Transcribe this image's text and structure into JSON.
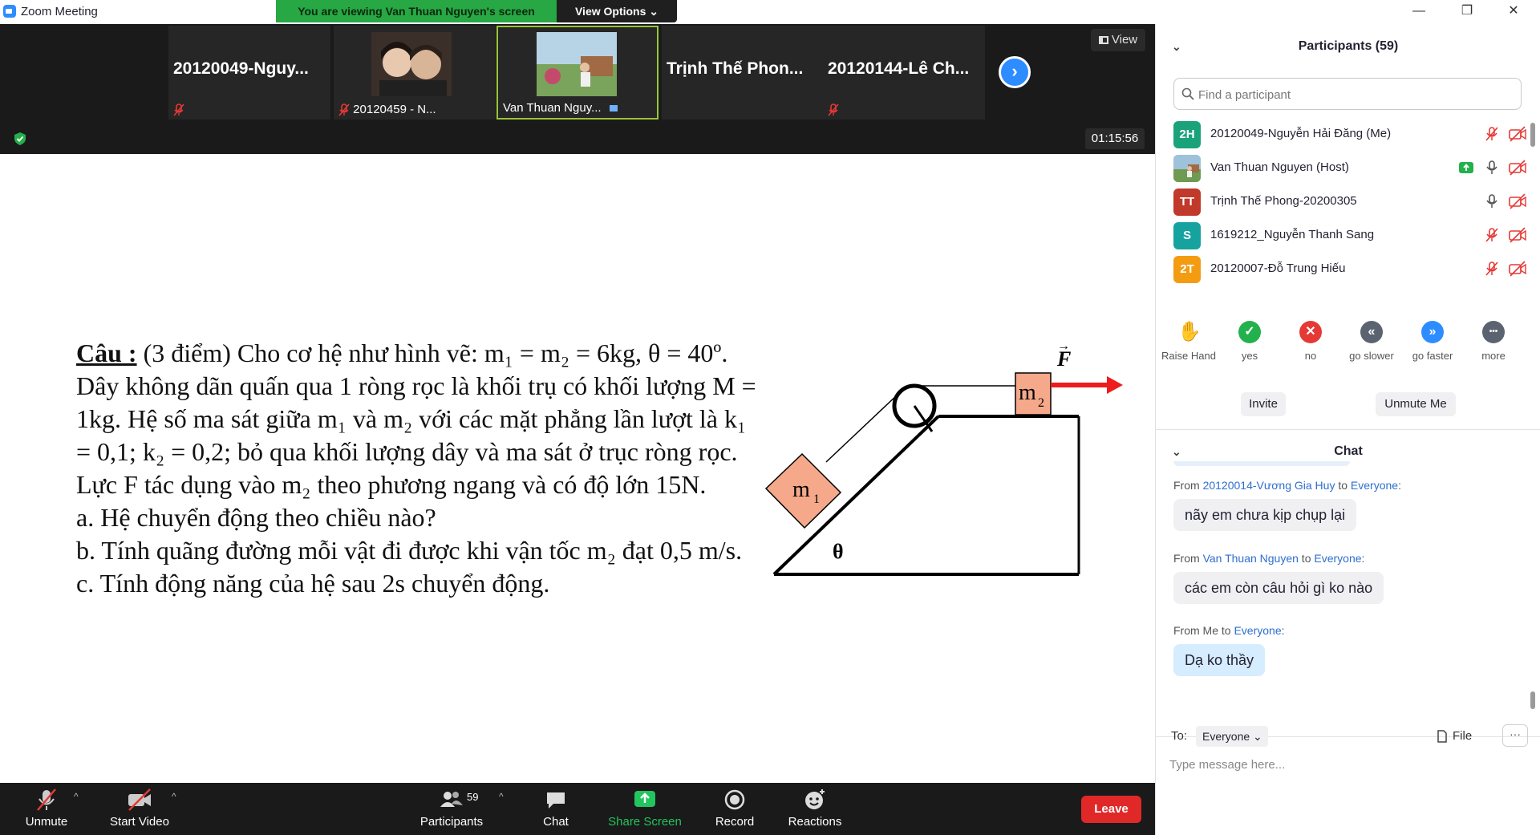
{
  "window": {
    "title": "Zoom Meeting",
    "viewing_banner": "You are viewing Van Thuan Nguyen's screen",
    "view_options": "View Options ⌄",
    "controls": {
      "minimize": "—",
      "restore": "❐",
      "close": "✕"
    }
  },
  "thumbnails": [
    {
      "name": "20120049-Nguy...",
      "caption": ""
    },
    {
      "name": "",
      "caption": "20120459 - N..."
    },
    {
      "name": "",
      "caption": "Van Thuan Nguy..."
    },
    {
      "name": "Trịnh Thế Phon...",
      "caption": ""
    },
    {
      "name": "20120144-Lê Ch...",
      "caption": ""
    }
  ],
  "stage": {
    "view_label": "View",
    "timer": "01:15:56",
    "next_arrow": "›"
  },
  "question": {
    "head": "Câu   :",
    "text": " (3 điểm) Cho cơ hệ như hình vẽ: m₁ = m₂ = 6kg, θ = 40º.\nDây không dãn quấn qua 1 ròng rọc là khối trụ có khối lượng M =\n1kg. Hệ số ma sát giữa m₁ và m₂ với các mặt phẳng lần lượt là k₁\n= 0,1; k₂ = 0,2; bỏ qua khối lượng dây và ma sát ở trục ròng rọc.\nLực F tác dụng vào m₂ theo phương ngang và có độ lớn 15N.\na.  Hệ chuyển động theo chiều nào?\nb.  Tính quãng đường mỗi vật đi được khi vận tốc m₂ đạt 0,5 m/s.\nc.  Tính động năng của hệ sau 2s chuyển động."
  },
  "diagram": {
    "mass1": "m",
    "mass1_sub": "1",
    "mass2": "m",
    "mass2_sub": "2",
    "angle": "θ",
    "force": "F",
    "force_arrow": "→",
    "block_color": "#f5a98a",
    "arrow_color": "#ee1c1c"
  },
  "toolbar": {
    "unmute": "Unmute",
    "start_video": "Start Video",
    "participants": "Participants",
    "participant_count": "59",
    "chat": "Chat",
    "share_screen": "Share Screen",
    "record": "Record",
    "reactions": "Reactions",
    "leave": "Leave",
    "caret": "^",
    "share_color": "#22c55e"
  },
  "panel": {
    "participants_title": "Participants (59)",
    "collapse": "⌄",
    "search_placeholder": "Find a participant",
    "participants": [
      {
        "initials": "2H",
        "color": "#1aa37a",
        "name": "20120049-Nguyễn Hải Đăng (Me)"
      },
      {
        "initials": "",
        "color": "#7a8f6b",
        "name": "Van Thuan Nguyen (Host)"
      },
      {
        "initials": "TT",
        "color": "#c0392b",
        "name": "Trịnh Thế Phong-20200305"
      },
      {
        "initials": "S",
        "color": "#16a3a0",
        "name": "1619212_Nguyễn Thanh Sang"
      },
      {
        "initials": "2T",
        "color": "#f39c12",
        "name": "20120007-Đỗ Trung Hiếu"
      }
    ],
    "reactions": [
      {
        "label": "Raise Hand",
        "symbol": "✋",
        "color": "#2d8cff"
      },
      {
        "label": "yes",
        "symbol": "✓",
        "color": "#22b14c"
      },
      {
        "label": "no",
        "symbol": "✕",
        "color": "#e53935"
      },
      {
        "label": "go slower",
        "symbol": "«",
        "color": "#5c6370"
      },
      {
        "label": "go faster",
        "symbol": "»",
        "color": "#2d8cff"
      },
      {
        "label": "more",
        "symbol": "•••",
        "color": "#5c6370"
      }
    ],
    "invite": "Invite",
    "unmute_me": "Unmute Me",
    "chat_title": "Chat",
    "messages": [
      {
        "prefix": "From ",
        "sender": "20120014-Vương Gia Huy",
        "mid": " to ",
        "to": "Everyone",
        "suffix": ":",
        "text": "nãy em chưa kịp chụp lại",
        "mine": false
      },
      {
        "prefix": "From ",
        "sender": "Van Thuan Nguyen",
        "mid": " to ",
        "to": "Everyone",
        "suffix": ":",
        "text": "các em còn câu hỏi gì ko nào",
        "mine": false
      },
      {
        "prefix": "From Me",
        "sender": "",
        "mid": " to ",
        "to": "Everyone",
        "suffix": ":",
        "text": "Dạ ko thầy",
        "mine": true
      }
    ],
    "to_label": "To:",
    "to_value": "Everyone ⌄",
    "file": "File",
    "more": "···",
    "message_placeholder": "Type message here..."
  }
}
